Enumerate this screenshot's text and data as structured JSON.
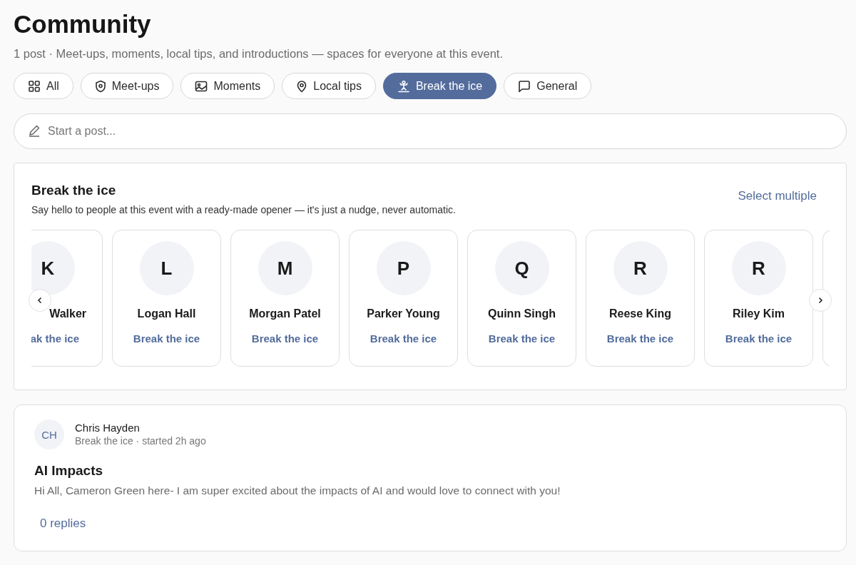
{
  "page": {
    "title": "Community",
    "subtitle": "1 post · Meet-ups, moments, local tips, and introductions — spaces for everyone at this event."
  },
  "filters": [
    {
      "label": "All",
      "kind": "grid",
      "selected": false
    },
    {
      "label": "Meet-ups",
      "kind": "shield",
      "selected": false
    },
    {
      "label": "Moments",
      "kind": "image",
      "selected": false
    },
    {
      "label": "Local tips",
      "kind": "pin",
      "selected": false
    },
    {
      "label": "Break the ice",
      "kind": "skater",
      "selected": true
    },
    {
      "label": "General",
      "kind": "chat",
      "selected": false
    }
  ],
  "composer": {
    "placeholder": "Start a post..."
  },
  "icebreaker": {
    "title": "Break the ice",
    "description": "Say hello to people at this event with a ready-made opener — it's just a nudge, never automatic.",
    "action": "Select multiple",
    "people": [
      {
        "initial": "K",
        "name": "Walker",
        "action": "ak the ice",
        "kind": "cut"
      },
      {
        "initial": "L",
        "name": "Logan Hall",
        "action": "Break the ice",
        "kind": "full"
      },
      {
        "initial": "M",
        "name": "Morgan Patel",
        "action": "Break the ice",
        "kind": "full"
      },
      {
        "initial": "P",
        "name": "Parker Young",
        "action": "Break the ice",
        "kind": "full"
      },
      {
        "initial": "Q",
        "name": "Quinn Singh",
        "action": "Break the ice",
        "kind": "full"
      },
      {
        "initial": "R",
        "name": "Reese King",
        "action": "Break the ice",
        "kind": "full"
      },
      {
        "initial": "R",
        "name": "Riley Kim",
        "action": "Break the ice",
        "kind": "full"
      }
    ]
  },
  "posts": [
    {
      "initials": "CH",
      "author": "Chris Hayden",
      "meta": "Break the ice · started 2h ago",
      "title": "AI Impacts",
      "body": "Hi All, Cameron Green here- I am super excited about the impacts of AI and would love to connect with you!",
      "replies": "0 replies"
    }
  ]
}
